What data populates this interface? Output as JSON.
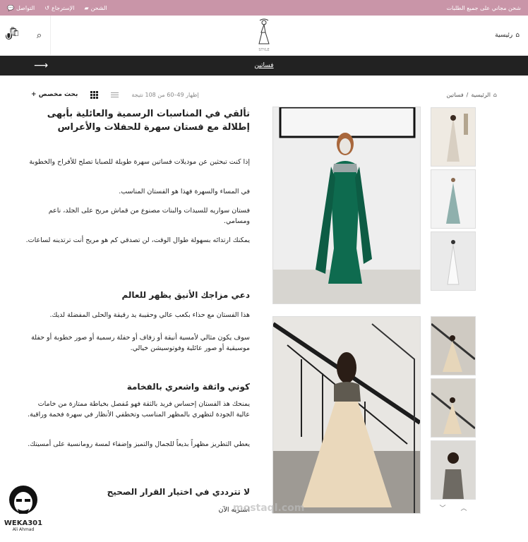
{
  "topbar": {
    "promo": "شحن مجاني على جميع الطلبات",
    "links": [
      {
        "icon": "truck-icon",
        "label": "الشحن"
      },
      {
        "icon": "undo-icon",
        "label": "الإسترجاع"
      },
      {
        "icon": "chat-icon",
        "label": "التواصل"
      }
    ]
  },
  "header": {
    "home_label": "رئيسية",
    "logo_text": "STYLE",
    "cart_count": "0"
  },
  "nav": {
    "category": "فساتين"
  },
  "toolbar": {
    "breadcrumb_home": "الرئيسية",
    "breadcrumb_current": "فساتين",
    "result_count": "إظهار 49–60 من 108 نتيجة",
    "advanced_search": "بحث مخصص"
  },
  "content": {
    "title": "تألقي في المناسبات الرسمية والعائلية بأبهى إطلالة مع فستان سهرة للحفلات والأعراس",
    "p1": "إذا كنت تبحثين عن موديلات فساتين سهرة طويلة للصبايا تصلح للأفراح والخطوبة",
    "p2": "في المساء والسهرة فهذا هو الفستان المناسب.",
    "p3": "فستان سواريه للسيدات والبنات مصنوع من قماش مريح على الجلد، ناعم ومسامي.",
    "p4": "يمكنك ارتدائه بسهولة طوال الوقت، لن تصدقي كم هو مريح أنت ترتدينه لساعات.",
    "h2": "دعي مزاجك الأنيق يظهر للعالم",
    "p5": "هذا الفستان مع حذاء بكعب عالي وحقيبة يد رقيقة والحلى المفضلة لديك.",
    "p6": "سوف يكون مثالي لأمسية أنيقة أو زفاف أو حفلة رسمية أو صور خطوبة أو حفلة موسيقية أو صور عائلية وفوتوسيشن خيالي.",
    "h3": "كوني واثقة واشعري بالفخامة",
    "p7": "يمنحك هذ الفستان إحساس فريد بالثقة فهو مُفصل بخياطة ممتازة من خامات عالية الجودة لتظهري بالمظهر المناسب وتخطفي الأنظار في سهرة فخمة وراقية.",
    "p8": "يعطي التطريز مظهراً بديعاً للجمال والتميز وإضفاء لمسة رومانسية على أمسيتك.",
    "h4": "لا تترددي في اختيار القرار الصحيح",
    "p9": "اشتريه الآن"
  },
  "watermark": {
    "name": "WEKA301",
    "sub": "Ali Ahmad",
    "site": "mostaql.com"
  },
  "colors": {
    "topbar": "#c995a8",
    "navbar": "#222222",
    "green_dress": "#0e6b4f"
  }
}
